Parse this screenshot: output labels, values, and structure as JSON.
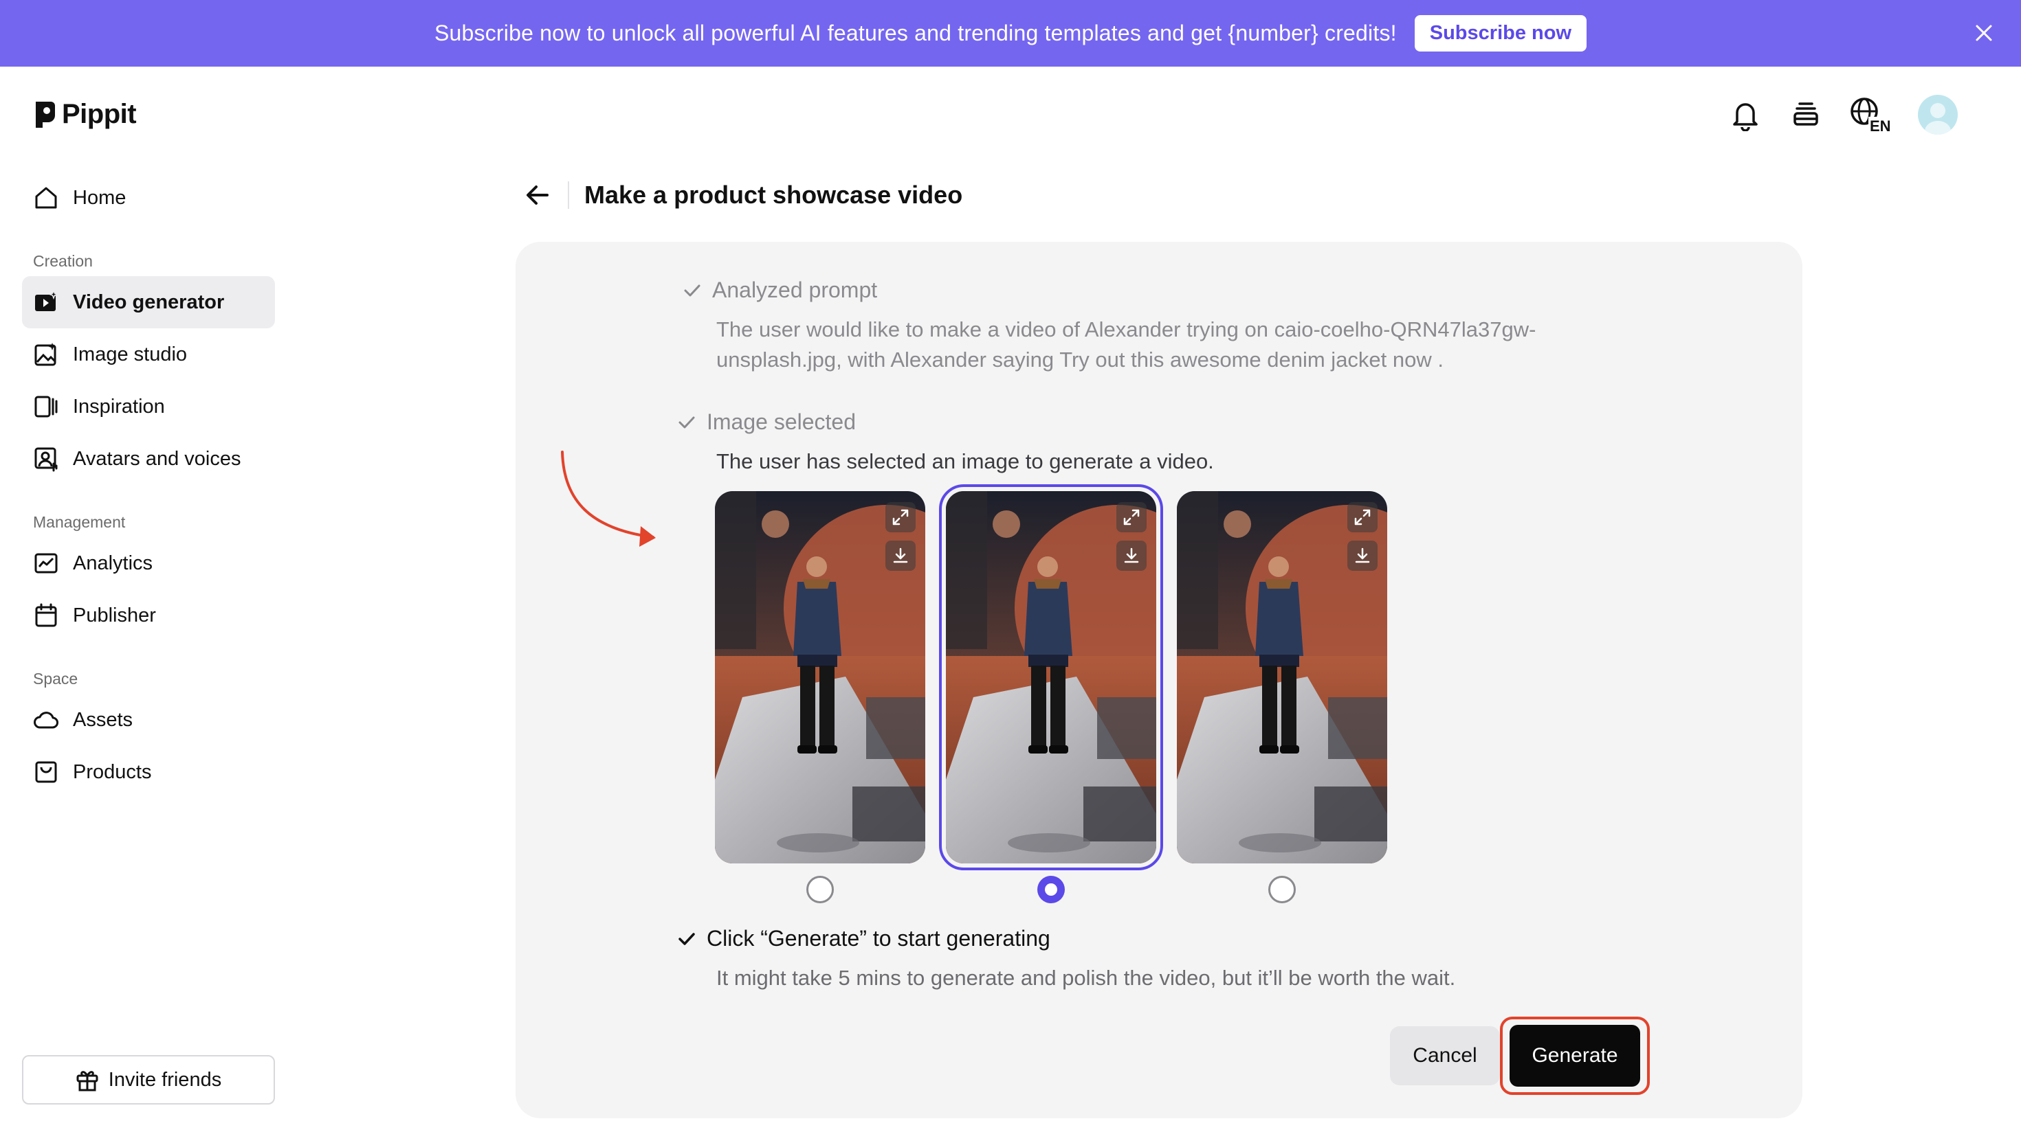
{
  "banner": {
    "text": "Subscribe now to unlock all powerful AI features and trending templates and get {number} credits!",
    "button_label": "Subscribe now",
    "background_color": "#7566f0"
  },
  "header": {
    "logo_text": "Pippit",
    "icons": [
      "bell-icon",
      "layers-icon",
      "language-icon",
      "avatar"
    ],
    "language_label": "EN"
  },
  "sidebar": {
    "home": "Home",
    "sections": [
      {
        "label": "Creation",
        "items": [
          "Video generator",
          "Image studio",
          "Inspiration",
          "Avatars and voices"
        ]
      },
      {
        "label": "Management",
        "items": [
          "Analytics",
          "Publisher"
        ]
      },
      {
        "label": "Space",
        "items": [
          "Assets",
          "Products"
        ]
      }
    ],
    "active_item": "Video generator",
    "invite_label": "Invite friends"
  },
  "main": {
    "title": "Make a product showcase video",
    "steps": [
      {
        "title": "Analyzed prompt",
        "description_line1": "The user would like to make a video of Alexander trying on caio-coelho-QRN47la37gw-",
        "description_line2": "unsplash.jpg, with Alexander saying Try out this awesome denim jacket now ."
      },
      {
        "title": "Image selected",
        "description": "The user has selected an image to generate a video."
      },
      {
        "title": "Click “Generate” to start generating",
        "description": "It might take 5 mins to generate and polish the video, but it’ll be worth the wait."
      }
    ],
    "images": [
      {
        "selected": false
      },
      {
        "selected": true
      },
      {
        "selected": false
      }
    ],
    "cancel_label": "Cancel",
    "generate_label": "Generate",
    "accent_color": "#5b49e8",
    "highlight_color": "#e2432b"
  }
}
